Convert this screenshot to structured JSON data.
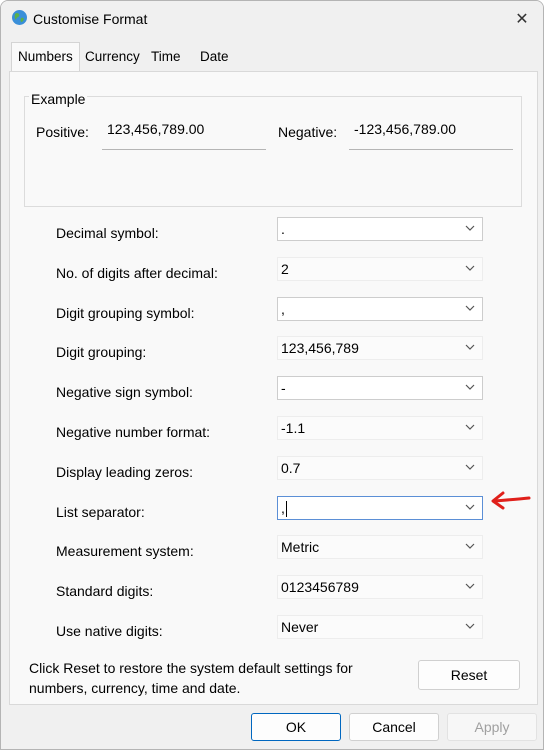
{
  "window": {
    "title": "Customise Format",
    "close_icon": "close-icon",
    "app_icon": "globe-icon"
  },
  "tabs": [
    {
      "label": "Numbers",
      "active": true
    },
    {
      "label": "Currency",
      "active": false
    },
    {
      "label": "Time",
      "active": false
    },
    {
      "label": "Date",
      "active": false
    }
  ],
  "example": {
    "label": "Example",
    "positive_label": "Positive:",
    "positive_value": "123,456,789.00",
    "negative_label": "Negative:",
    "negative_value": "-123,456,789.00"
  },
  "settings": [
    {
      "label": "Decimal symbol:",
      "value": ".",
      "editable": true
    },
    {
      "label": "No. of digits after decimal:",
      "value": "2",
      "editable": false
    },
    {
      "label": "Digit grouping symbol:",
      "value": ",",
      "editable": true
    },
    {
      "label": "Digit grouping:",
      "value": "123,456,789",
      "editable": false
    },
    {
      "label": "Negative sign symbol:",
      "value": "-",
      "editable": true
    },
    {
      "label": "Negative number format:",
      "value": "-1.1",
      "editable": false
    },
    {
      "label": "Display leading zeros:",
      "value": "0.7",
      "editable": false
    },
    {
      "label": "List separator:",
      "value": ",",
      "editable": true,
      "focused": true
    },
    {
      "label": "Measurement system:",
      "value": "Metric",
      "editable": false
    },
    {
      "label": "Standard digits:",
      "value": "0123456789",
      "editable": false
    },
    {
      "label": "Use native digits:",
      "value": "Never",
      "editable": false
    }
  ],
  "reset": {
    "note": "Click Reset to restore the system default settings for numbers, currency, time and date.",
    "button_label": "Reset"
  },
  "footer": {
    "ok_label": "OK",
    "cancel_label": "Cancel",
    "apply_label": "Apply"
  },
  "annotation": {
    "color": "#e0201b"
  },
  "colors": {
    "focus_border": "#5b8fd6",
    "default_button": "#0067c0"
  }
}
